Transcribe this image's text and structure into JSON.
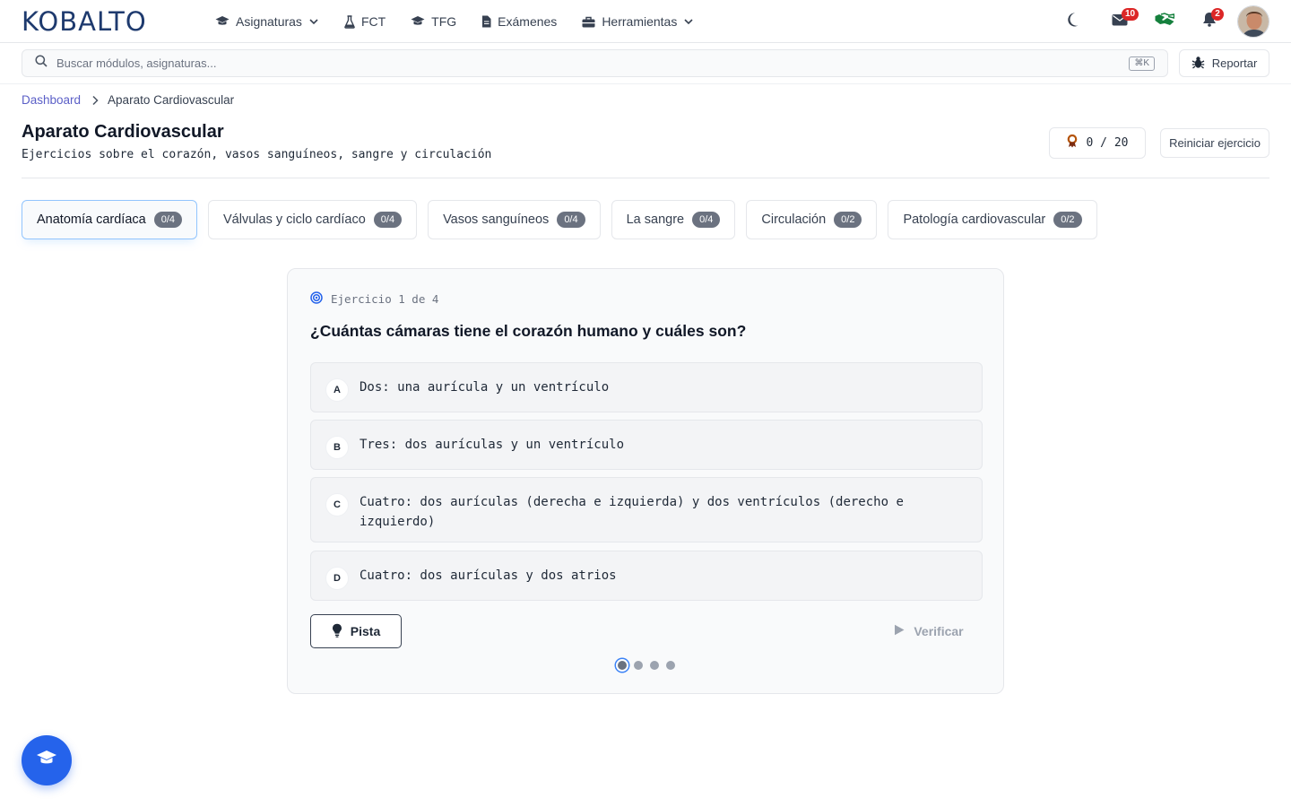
{
  "brand": {
    "logo_text": "KOBALTO"
  },
  "nav": {
    "items": [
      {
        "label": "Asignaturas",
        "icon": "graduation-cap-icon",
        "has_dropdown": true
      },
      {
        "label": "FCT",
        "icon": "flask-icon",
        "has_dropdown": false
      },
      {
        "label": "TFG",
        "icon": "graduation-cap-icon",
        "has_dropdown": false
      },
      {
        "label": "Exámenes",
        "icon": "document-icon",
        "has_dropdown": false
      },
      {
        "label": "Herramientas",
        "icon": "toolbox-icon",
        "has_dropdown": true
      }
    ],
    "messages_count": "10",
    "notifications_count": "2"
  },
  "search": {
    "placeholder": "Buscar módulos, asignaturas...",
    "shortcut": "⌘K"
  },
  "report_button": {
    "label": "Reportar"
  },
  "breadcrumb": {
    "home": "Dashboard",
    "current": "Aparato Cardiovascular"
  },
  "header": {
    "title": "Aparato Cardiovascular",
    "subtitle": "Ejercicios sobre el corazón, vasos sanguíneos, sangre y circulación",
    "score": "0 / 20",
    "reset_label": "Reiniciar ejercicio"
  },
  "tabs": [
    {
      "label": "Anatomía cardíaca",
      "count": "0/4",
      "active": true
    },
    {
      "label": "Válvulas y ciclo cardíaco",
      "count": "0/4",
      "active": false
    },
    {
      "label": "Vasos sanguíneos",
      "count": "0/4",
      "active": false
    },
    {
      "label": "La sangre",
      "count": "0/4",
      "active": false
    },
    {
      "label": "Circulación",
      "count": "0/2",
      "active": false
    },
    {
      "label": "Patología cardiovascular",
      "count": "0/2",
      "active": false
    }
  ],
  "exercise": {
    "progress_label": "Ejercicio 1 de 4",
    "question": "¿Cuántas cámaras tiene el corazón humano y cuáles son?",
    "options": [
      {
        "letter": "A",
        "text": "Dos: una aurícula y un ventrículo"
      },
      {
        "letter": "B",
        "text": "Tres: dos aurículas y un ventrículo"
      },
      {
        "letter": "C",
        "text": "Cuatro: dos aurículas (derecha e izquierda) y dos ventrículos (derecho e izquierdo)"
      },
      {
        "letter": "D",
        "text": "Cuatro: dos aurículas y dos atrios"
      }
    ],
    "hint_label": "Pista",
    "verify_label": "Verificar",
    "total_steps": 4,
    "current_step": 1
  },
  "colors": {
    "brand": "#1e3a6e",
    "accent": "#2563eb",
    "link": "#5b5fc7",
    "badge": "#dc2626",
    "handshake": "#15803d"
  }
}
